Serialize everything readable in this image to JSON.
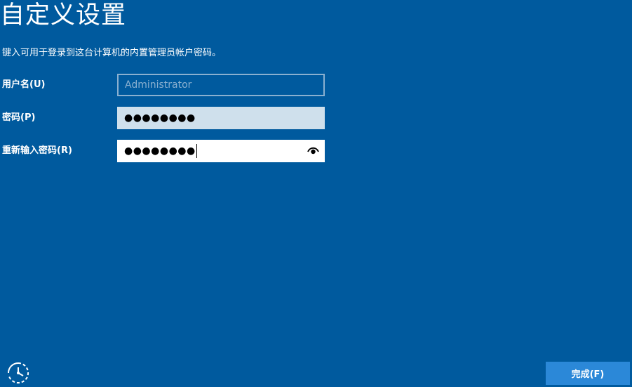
{
  "page": {
    "title": "自定义设置",
    "subtitle": "键入可用于登录到这台计算机的内置管理员帐户密码。"
  },
  "fields": {
    "username_label": "用户名(U)",
    "username_placeholder": "Administrator",
    "password_label": "密码(P)",
    "password_value": "●●●●●●●●",
    "confirm_label": "重新输入密码(R)",
    "confirm_value": "●●●●●●●●"
  },
  "footer": {
    "finish_label": "完成(F)"
  },
  "icons": {
    "reveal": "eye-icon",
    "ease_of_access": "ease-of-access-icon"
  },
  "colors": {
    "background": "#005a9e",
    "button": "#2b88d8",
    "disabled_field_border": "#8ab0d0",
    "password_field_bg": "#cfe0ec"
  }
}
